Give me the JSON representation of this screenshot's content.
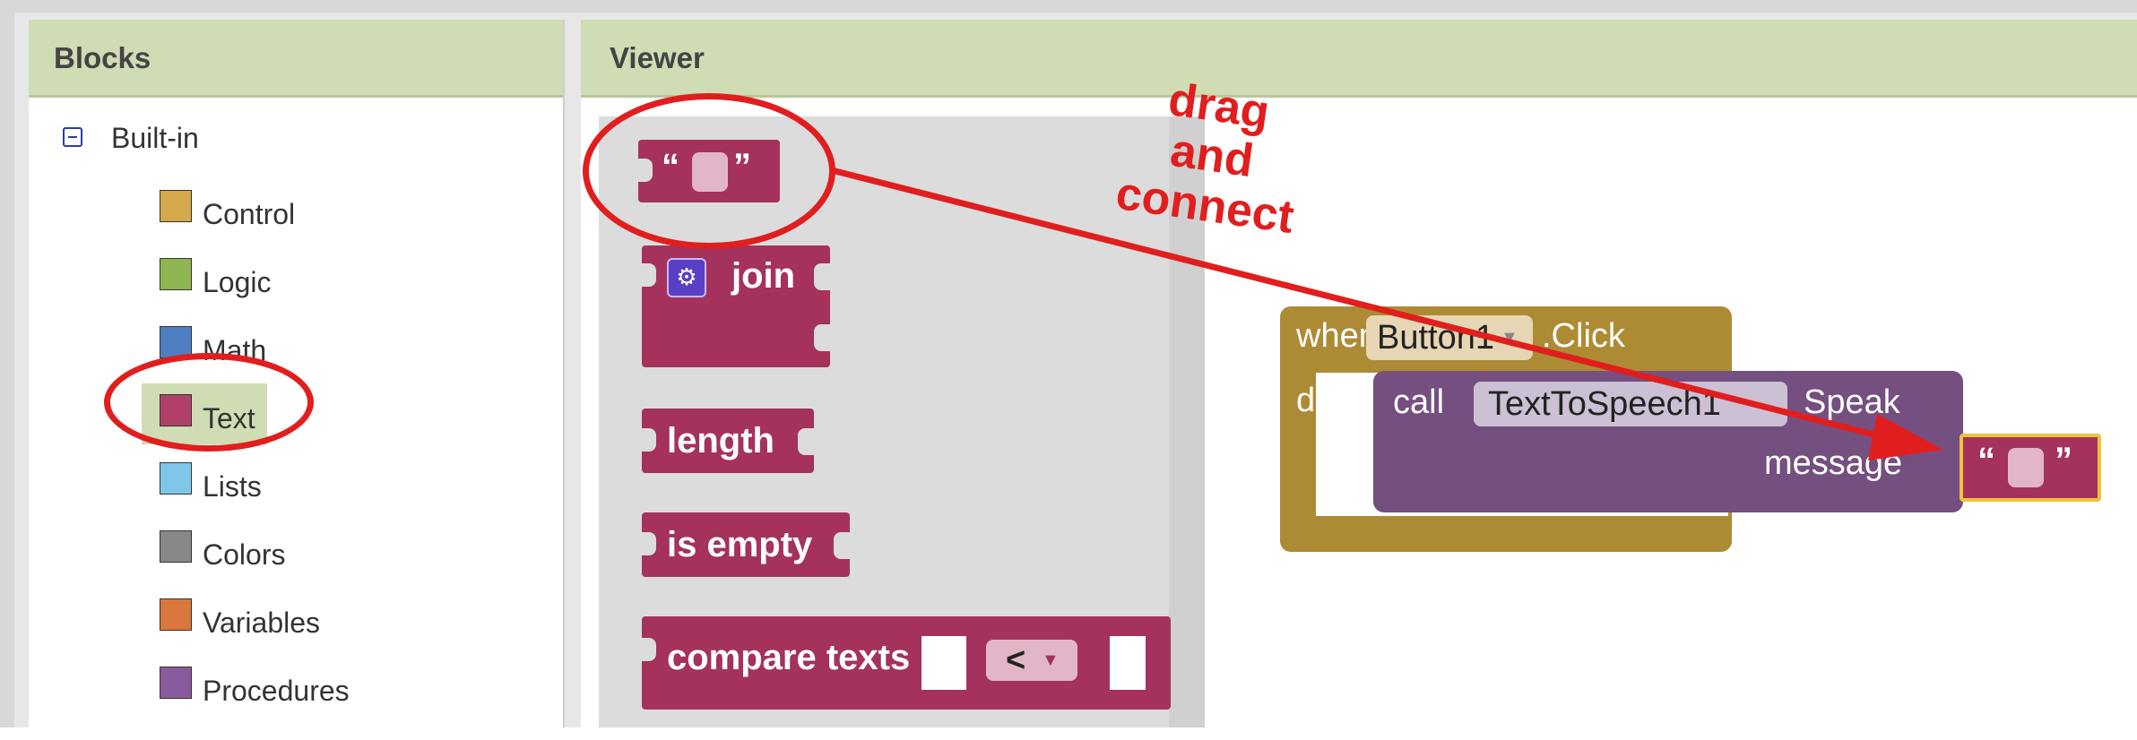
{
  "blocks_panel": {
    "title": "Blocks",
    "group_label": "Built-in",
    "categories": [
      {
        "label": "Control",
        "color": "#d3a94b"
      },
      {
        "label": "Logic",
        "color": "#8fb54f"
      },
      {
        "label": "Math",
        "color": "#4f7fc2"
      },
      {
        "label": "Text",
        "color": "#b0406a"
      },
      {
        "label": "Lists",
        "color": "#7fc6e8"
      },
      {
        "label": "Colors",
        "color": "#888888"
      },
      {
        "label": "Variables",
        "color": "#d9773d"
      },
      {
        "label": "Procedures",
        "color": "#8a5a9e"
      }
    ]
  },
  "viewer": {
    "title": "Viewer",
    "flyout_blocks": {
      "text_open_quote": "“",
      "text_close_quote": "”",
      "join": "join",
      "length": "length",
      "is_empty": "is empty",
      "compare": "compare texts",
      "compare_op": "<"
    },
    "event_block": {
      "when": "when",
      "component": "Button1",
      "event": ".Click",
      "do": "do",
      "call": "call",
      "target": "TextToSpeech1",
      "method": "Speak",
      "arg": "message"
    }
  },
  "annotation": {
    "line1": "drag",
    "line2": "and",
    "line3": "connect"
  },
  "colors": {
    "text_block": "#a4325c",
    "event_block": "#ad8b35",
    "call_block": "#744f80",
    "annotation": "#e11e1e"
  }
}
